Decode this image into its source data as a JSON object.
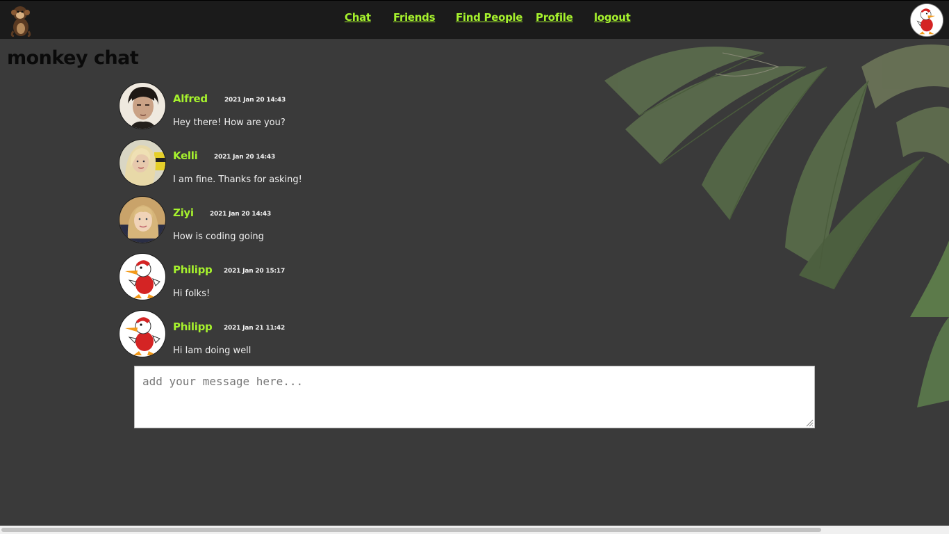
{
  "nav": {
    "links": [
      "Chat",
      "Friends",
      "Find People",
      "Profile",
      "logout"
    ]
  },
  "page": {
    "title": "monkey chat"
  },
  "messages": [
    {
      "author": "Alfred",
      "timestamp": "2021 Jan 20 14:43",
      "text": "Hey there! How are you?",
      "avatar": "alfred-avatar"
    },
    {
      "author": "Kelli",
      "timestamp": "2021 Jan 20 14:43",
      "text": "I am fine. Thanks for asking!",
      "avatar": "kelli-avatar"
    },
    {
      "author": "Ziyi",
      "timestamp": "2021 Jan 20 14:43",
      "text": "How is coding going",
      "avatar": "ziyi-avatar"
    },
    {
      "author": "Philipp",
      "timestamp": "2021 Jan 20 15:17",
      "text": "Hi folks!",
      "avatar": "duck-avatar"
    },
    {
      "author": "Philipp",
      "timestamp": "2021 Jan 21 11:42",
      "text": "Hi Iam doing well",
      "avatar": "duck-avatar"
    }
  ],
  "composer": {
    "placeholder": "add your message here...",
    "value": ""
  },
  "colors": {
    "accent": "#a6f22d",
    "background": "#3a3a3a",
    "navbar": "#1b1b1b"
  }
}
